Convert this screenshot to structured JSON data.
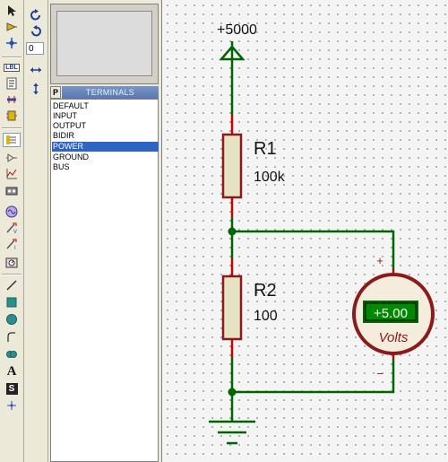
{
  "toolbar": {
    "tools": [
      {
        "name": "selection-mode-icon",
        "icon": "arrow"
      },
      {
        "name": "component-mode-icon",
        "icon": "component"
      },
      {
        "name": "junction-dot-mode-icon",
        "icon": "junction"
      },
      {
        "name": "wire-label-mode-icon",
        "icon": "label",
        "text": "LBL"
      },
      {
        "name": "text-script-mode-icon",
        "icon": "script"
      },
      {
        "name": "buses-mode-icon",
        "icon": "bus"
      },
      {
        "name": "subcircuit-mode-icon",
        "icon": "subcircuit"
      },
      {
        "name": "terminals-mode-icon",
        "icon": "terminals"
      },
      {
        "name": "device-pins-mode-icon",
        "icon": "pins"
      },
      {
        "name": "graph-mode-icon",
        "icon": "graph"
      },
      {
        "name": "tape-recorder-mode-icon",
        "icon": "tape"
      },
      {
        "name": "generator-mode-icon",
        "icon": "generator"
      },
      {
        "name": "voltage-probe-mode-icon",
        "icon": "vprobe"
      },
      {
        "name": "current-probe-mode-icon",
        "icon": "iprobe"
      },
      {
        "name": "virtual-instruments-mode-icon",
        "icon": "instrument"
      },
      {
        "name": "line-tool-icon",
        "icon": "line"
      },
      {
        "name": "box-tool-icon",
        "icon": "box"
      },
      {
        "name": "circle-tool-icon",
        "icon": "circle"
      },
      {
        "name": "arc-tool-icon",
        "icon": "arc"
      },
      {
        "name": "path-tool-icon",
        "icon": "path"
      },
      {
        "name": "text-tool-icon",
        "icon": "text",
        "text": "A"
      },
      {
        "name": "symbol-tool-icon",
        "icon": "symbol",
        "text": "S"
      },
      {
        "name": "marker-tool-icon",
        "icon": "marker"
      }
    ]
  },
  "rotation": {
    "angle": "0"
  },
  "picker": {
    "p_label": "P",
    "title": "TERMINALS",
    "items": [
      "DEFAULT",
      "INPUT",
      "OUTPUT",
      "BIDIR",
      "POWER",
      "GROUND",
      "BUS"
    ],
    "selected": "POWER"
  },
  "schematic": {
    "power_label": "+5000",
    "r1": {
      "ref": "R1",
      "value": "100k"
    },
    "r2": {
      "ref": "R2",
      "value": "100"
    },
    "voltmeter": {
      "reading": "+5.00",
      "unit": "Volts",
      "plus": "+",
      "minus": "−"
    }
  },
  "colors": {
    "wire": "#006400",
    "pin": "#cc0000",
    "body": "#e8e2c4",
    "meter_face": "#f4ecdc",
    "meter_ring": "#8b1a1a",
    "lcd_bg": "#008a00",
    "selection": "#3163c5"
  }
}
